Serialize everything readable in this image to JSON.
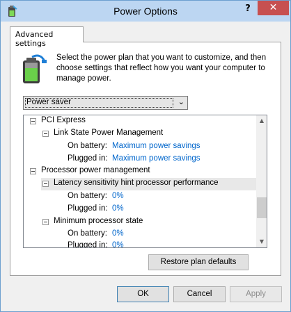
{
  "window": {
    "title": "Power Options",
    "help_label": "?",
    "close_label": "✕"
  },
  "tab": {
    "label": "Advanced settings"
  },
  "description": "Select the power plan that you want to customize, and then choose settings that reflect how you want your computer to manage power.",
  "plan_select": {
    "value": "Power saver"
  },
  "tree": {
    "pci_express": "PCI Express",
    "link_state": "Link State Power Management",
    "link_state_on_battery_label": "On battery:",
    "link_state_on_battery_value": "Maximum power savings",
    "link_state_plugged_in_label": "Plugged in:",
    "link_state_plugged_in_value": "Maximum power savings",
    "processor_pm": "Processor power management",
    "latency": "Latency sensitivity hint processor performance",
    "latency_on_battery_label": "On battery:",
    "latency_on_battery_value": "0%",
    "latency_plugged_in_label": "Plugged in:",
    "latency_plugged_in_value": "0%",
    "min_state": "Minimum processor state",
    "min_on_battery_label": "On battery:",
    "min_on_battery_value": "0%",
    "min_plugged_in_label": "Plugged in:",
    "min_plugged_in_value": "0%"
  },
  "buttons": {
    "restore": "Restore plan defaults",
    "ok": "OK",
    "cancel": "Cancel",
    "apply": "Apply"
  },
  "colors": {
    "link": "#0066cc",
    "close": "#c75050",
    "titlebar": "#bcd6f2"
  }
}
